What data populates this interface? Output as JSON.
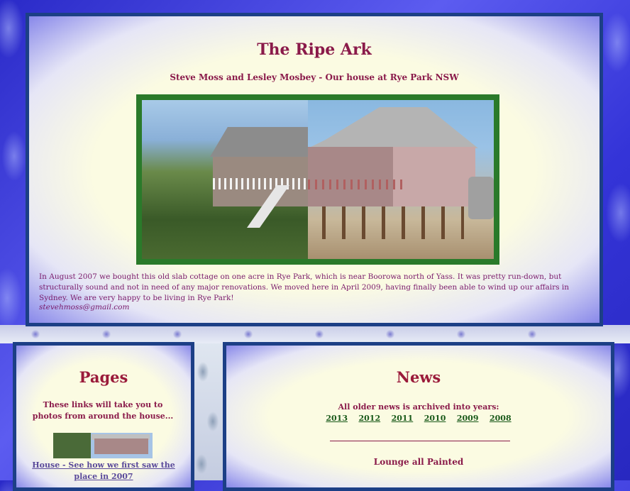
{
  "header": {
    "title": "The Ripe Ark",
    "subtitle": "Steve Moss and Lesley Mosbey - Our house at Rye Park NSW"
  },
  "intro": {
    "text": "In August 2007 we bought this old slab cottage on one acre in Rye Park, which is near Boorowa north of Yass. It was pretty run-down, but structurally sound and not in need of any major renovations. We moved here in April 2009, having finally been able to wind up our affairs in Sydney. We are very happy to be living in Rye Park!",
    "email": "stevehmoss@gmail.com"
  },
  "pages": {
    "heading": "Pages",
    "description": "These links will take you to photos from around the house...",
    "links": [
      {
        "label": "House - See how we first saw the place in 2007"
      }
    ]
  },
  "news": {
    "heading": "News",
    "archive_label": "All older news is archived into years:",
    "years": [
      "2013",
      "2012",
      "2011",
      "2010",
      "2009",
      "2008"
    ],
    "latest_title": "Lounge all Painted"
  },
  "colors": {
    "heading": "#8a1a4a",
    "panel_border": "#1c3f86",
    "photo_frame": "#2a7a2a",
    "year_link": "#1a5a1a",
    "background": "#3a3ad6"
  }
}
